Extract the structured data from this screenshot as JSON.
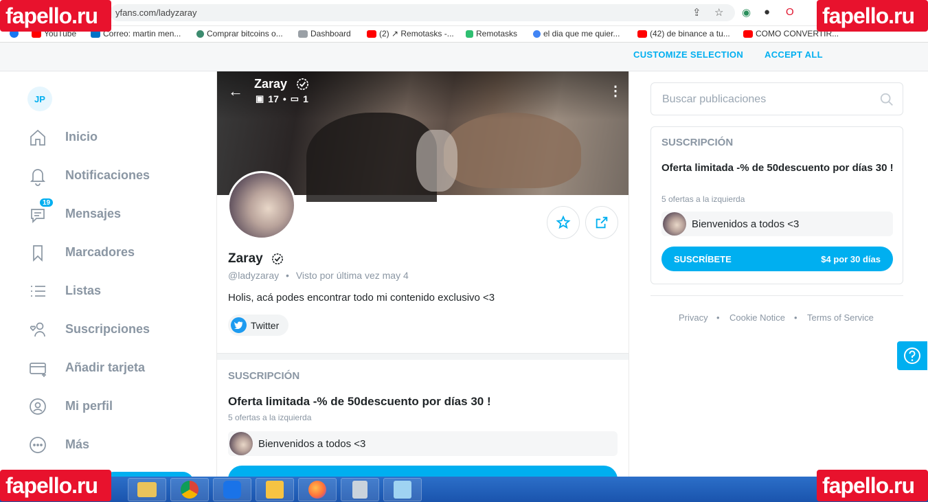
{
  "browser": {
    "url": "yfans.com/ladyzaray",
    "bookmarks": [
      {
        "label": "YouTube",
        "color": "#ff0000"
      },
      {
        "label": "Correo: martin men...",
        "color": "#0072c6"
      },
      {
        "label": "Comprar bitcoins o...",
        "color": "#3d8b6f"
      },
      {
        "label": "Dashboard",
        "color": "#9aa0a6"
      },
      {
        "label": "(2) ↗ Remotasks -...",
        "color": "#ff0000"
      },
      {
        "label": "Remotasks",
        "color": "#2fbf71"
      },
      {
        "label": "el dia que me quier...",
        "color": "#4285f4"
      },
      {
        "label": "(42) de binance a tu...",
        "color": "#ff0000"
      },
      {
        "label": "COMO CONVERTIR...",
        "color": "#ff0000"
      }
    ]
  },
  "cookie": {
    "customize": "CUSTOMIZE SELECTION",
    "accept": "ACCEPT ALL"
  },
  "sidebar": {
    "avatar_initials": "JP",
    "items": [
      {
        "label": "Inicio",
        "icon": "home-icon"
      },
      {
        "label": "Notificaciones",
        "icon": "bell-icon"
      },
      {
        "label": "Mensajes",
        "icon": "message-icon",
        "badge": "19"
      },
      {
        "label": "Marcadores",
        "icon": "bookmark-icon"
      },
      {
        "label": "Listas",
        "icon": "list-icon"
      },
      {
        "label": "Suscripciones",
        "icon": "user-heart-icon"
      },
      {
        "label": "Añadir tarjeta",
        "icon": "card-icon"
      },
      {
        "label": "Mi perfil",
        "icon": "profile-icon"
      },
      {
        "label": "Más",
        "icon": "more-icon"
      }
    ]
  },
  "profile": {
    "cover_name": "Zaray",
    "photos": "17",
    "videos": "1",
    "name": "Zaray",
    "handle": "@ladyzaray",
    "separator": "•",
    "last_seen": "Visto por última vez may 4",
    "bio": "Holis, acá podes encontrar todo mi contenido exclusivo <3",
    "twitter": "Twitter"
  },
  "subscription": {
    "title": "SUSCRIPCIÓN",
    "offer": "Oferta limitada -% de 50descuento por días 30 !",
    "remaining": "5 ofertas a la izquierda",
    "welcome": "Bienvenidos a todos <3",
    "button": "SUSCRÍBETE",
    "price": "$4 por 30 días"
  },
  "right": {
    "search_placeholder": "Buscar publicaciones",
    "footer": [
      "Privacy",
      "Cookie Notice",
      "Terms of Service"
    ],
    "footer_sep": "•"
  },
  "watermark": "fapello.ru",
  "colors": {
    "accent": "#00aff0",
    "muted": "#8a96a3",
    "watermark": "#e8122d",
    "taskbar": "#1f5fbf"
  }
}
